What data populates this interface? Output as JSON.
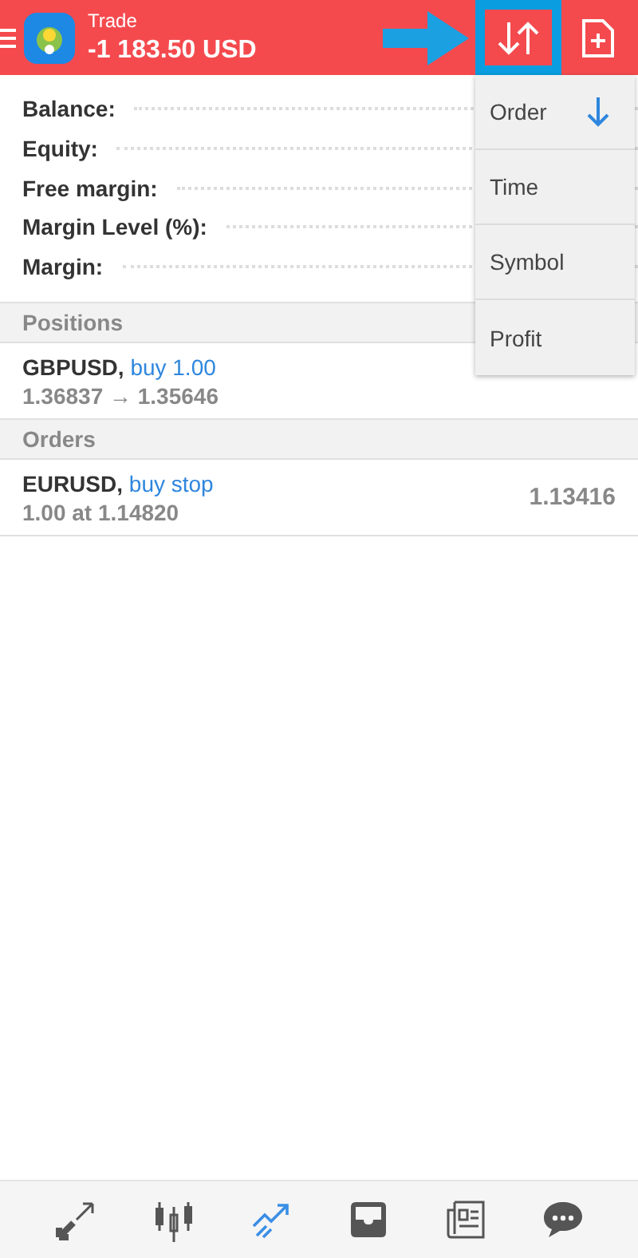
{
  "header": {
    "title": "Trade",
    "amount": "-1 183.50 USD"
  },
  "summary": [
    {
      "label": "Balance:"
    },
    {
      "label": "Equity:"
    },
    {
      "label": "Free margin:"
    },
    {
      "label": "Margin Level (%):"
    },
    {
      "label": "Margin:"
    }
  ],
  "sections": [
    {
      "title": "Positions",
      "rows": [
        {
          "symbol": "GBPUSD,",
          "action": "buy 1.00",
          "detail": "1.36837 → 1.35646"
        }
      ]
    },
    {
      "title": "Orders",
      "rows": [
        {
          "symbol": "EURUSD,",
          "action": "buy stop",
          "detail": "1.00 at 1.14820",
          "value": "1.13416"
        }
      ]
    }
  ],
  "sort_menu": [
    {
      "label": "Order",
      "selected": true
    },
    {
      "label": "Time",
      "selected": false
    },
    {
      "label": "Symbol",
      "selected": false
    },
    {
      "label": "Profit",
      "selected": false
    }
  ],
  "nav": [
    {
      "selected": false
    },
    {
      "selected": false
    },
    {
      "selected": true
    },
    {
      "selected": false
    },
    {
      "selected": false
    },
    {
      "selected": false
    }
  ]
}
